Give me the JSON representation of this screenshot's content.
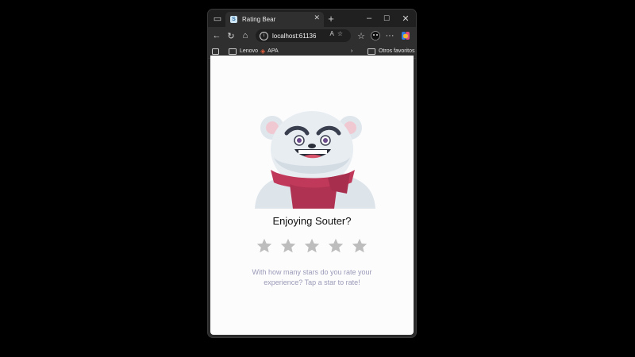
{
  "tab": {
    "title": "Rating Bear"
  },
  "address": {
    "url": "localhost:61136"
  },
  "bookmarks": {
    "items": [
      "Lenovo",
      "APA"
    ],
    "other": "Otros favoritos"
  },
  "page": {
    "title": "Enjoying Souter?",
    "rating_max": 5,
    "rating_value": 0,
    "hint": "With how many stars do you rate your experience? Tap a star to rate!"
  },
  "colors": {
    "star_inactive": "#bdbdbd",
    "scarf": "#c0395a",
    "bear_fur": "#e6ebf0",
    "hint_text": "#9a9ab8"
  }
}
